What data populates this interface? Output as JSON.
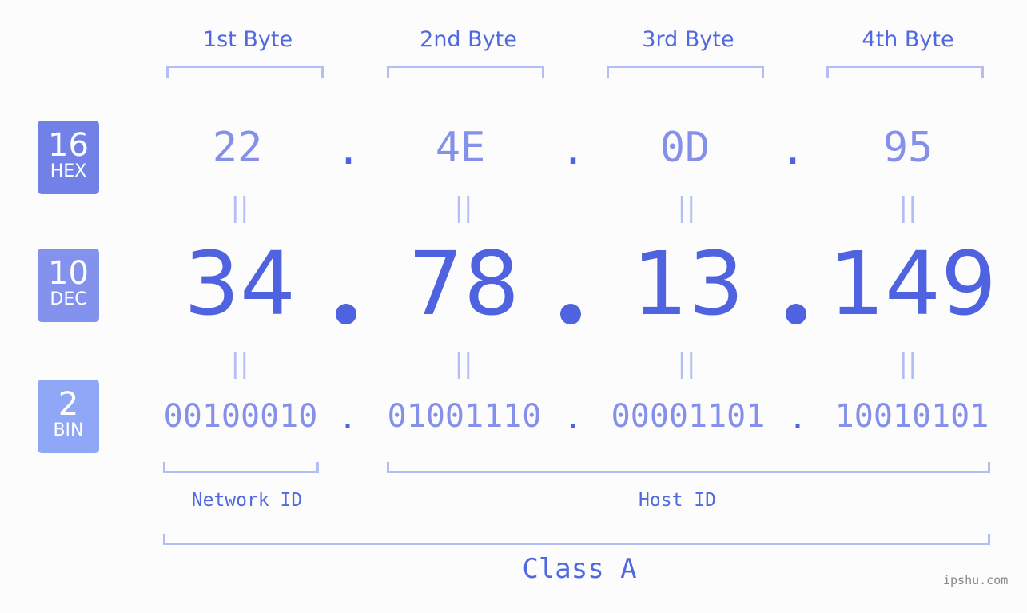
{
  "byte_headers": [
    "1st Byte",
    "2nd Byte",
    "3rd Byte",
    "4th Byte"
  ],
  "badges": {
    "hex": {
      "num": "16",
      "label": "HEX",
      "color": "#7281e8"
    },
    "dec": {
      "num": "10",
      "label": "DEC",
      "color": "#8392ed"
    },
    "bin": {
      "num": "2",
      "label": "BIN",
      "color": "#8fa7f6"
    }
  },
  "hex": [
    "22",
    "4E",
    "0D",
    "95"
  ],
  "dec": [
    "34",
    "78",
    "13",
    "149"
  ],
  "bin": [
    "00100010",
    "01001110",
    "00001101",
    "10010101"
  ],
  "separator": ".",
  "equals": "||",
  "network_label": "Network ID",
  "host_label": "Host ID",
  "class_label": "Class A",
  "watermark": "ipshu.com"
}
